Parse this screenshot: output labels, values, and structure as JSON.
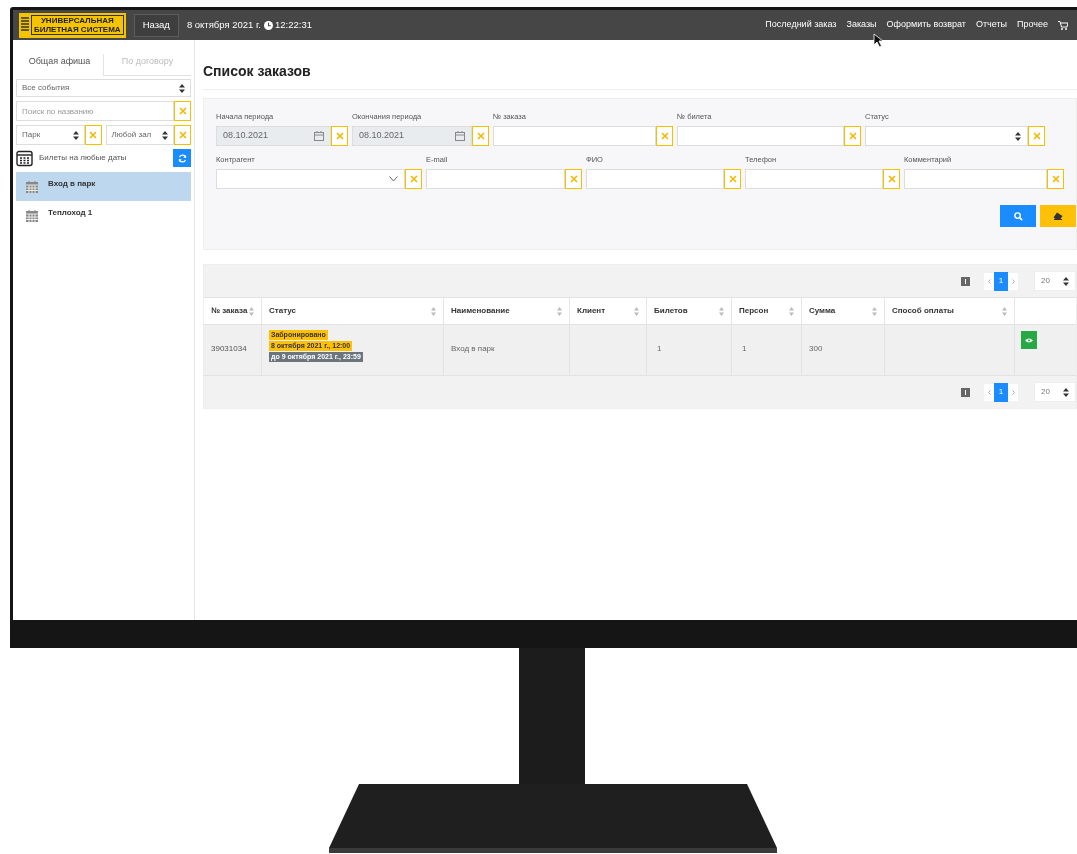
{
  "topbar": {
    "logo_lines": [
      "УНИВЕРСАЛЬНАЯ",
      "БИЛЕТНАЯ СИСТЕМА"
    ],
    "back_button": "Назад",
    "date": "8 октября 2021 г.",
    "time": "12:22:31",
    "nav": [
      {
        "label": "Последний заказ"
      },
      {
        "label": "Заказы"
      },
      {
        "label": "Оформить возврат"
      },
      {
        "label": "Отчеты"
      },
      {
        "label": "Прочее"
      }
    ]
  },
  "sidebar": {
    "tabs": [
      {
        "label": "Общая афиша",
        "selected": true
      },
      {
        "label": "По договору",
        "selected": false
      }
    ],
    "event_select": "Все события",
    "search": {
      "placeholder": "Поиск по названию"
    },
    "venue_select": "Парк",
    "hall_select": "Любой зал",
    "any_dates": "Билеты на любые даты",
    "events": [
      {
        "name": "Вход в парк",
        "selected": true
      },
      {
        "name": "Теплоход 1",
        "selected": false
      }
    ]
  },
  "page_title": "Список заказов",
  "filters": [
    [
      {
        "label": "Начала периода",
        "kind": "date",
        "value": "08.10.2021"
      },
      {
        "label": "Окончания периода",
        "kind": "date",
        "value": "08.10.2021"
      },
      {
        "label": "№ заказа",
        "kind": "text"
      },
      {
        "label": "№ билета",
        "kind": "text"
      },
      {
        "label": "Статус",
        "kind": "select"
      }
    ],
    [
      {
        "label": "Контрагент",
        "kind": "combo"
      },
      {
        "label": "E-mail",
        "kind": "text"
      },
      {
        "label": "ФИО",
        "kind": "text"
      },
      {
        "label": "Телефон",
        "kind": "text"
      },
      {
        "label": "Комментарий",
        "kind": "text"
      }
    ]
  ],
  "table": {
    "pagers": [
      {
        "pages": [
          {
            "label": "1",
            "selected": true
          }
        ],
        "page_size": "20"
      },
      {
        "pages": [
          {
            "label": "1",
            "selected": true
          }
        ],
        "page_size": "20"
      }
    ],
    "columns": [
      "№ заказа",
      "Статус",
      "Наименование",
      "Клиент",
      "Билетов",
      "Персон",
      "Сумма",
      "Способ оплаты"
    ],
    "rows": [
      {
        "order": "39031034",
        "status": "Забронировано",
        "status_date": "8 октября 2021 г., 12:00",
        "status_until": "до 9 октября 2021 г., 23:59",
        "name": "Вход в парк",
        "tickets": "1",
        "persons": "1",
        "sum": "300"
      }
    ]
  }
}
